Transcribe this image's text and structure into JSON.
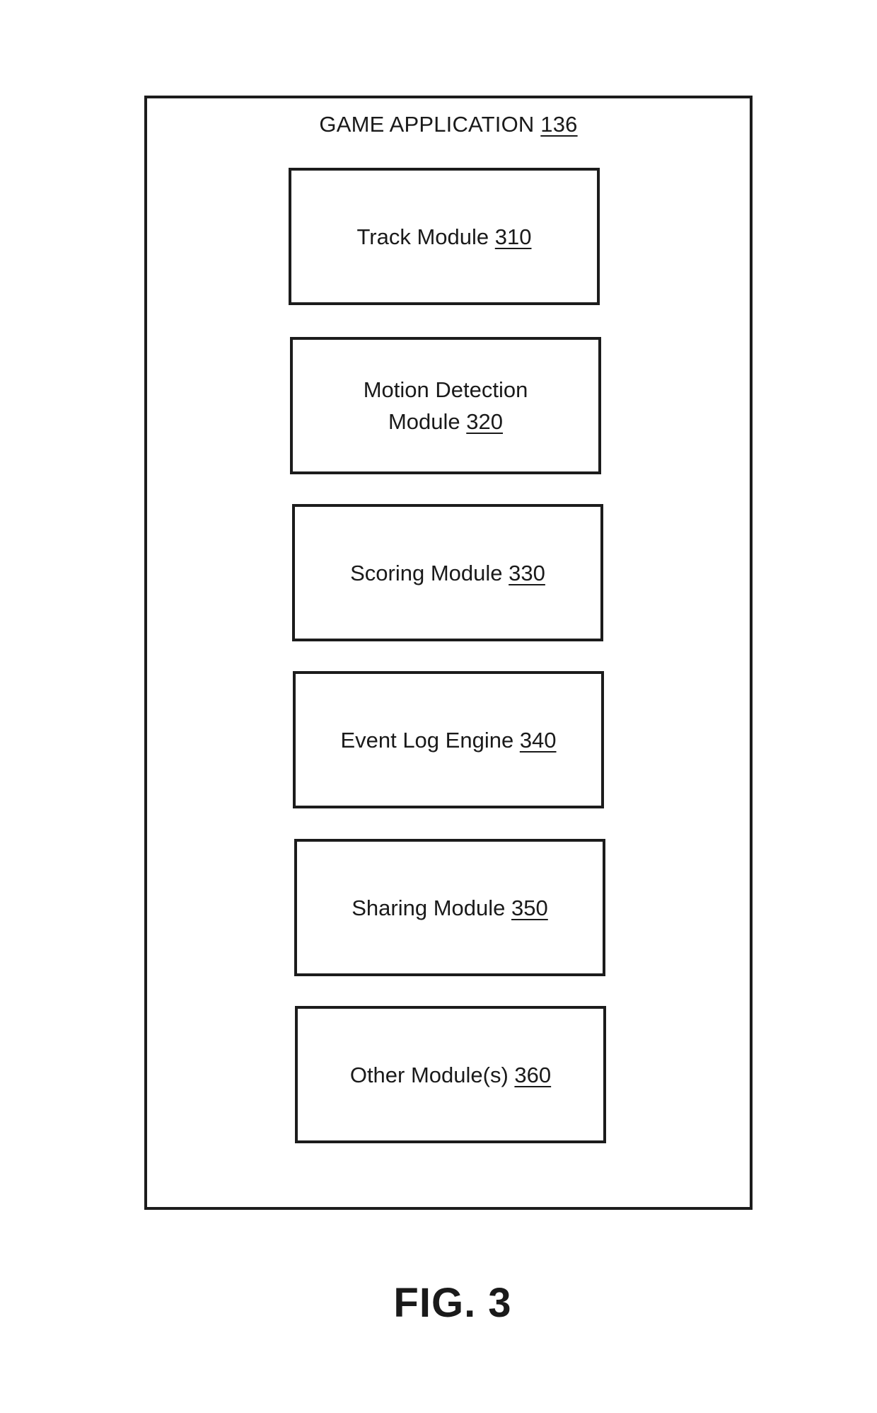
{
  "container": {
    "title": "GAME APPLICATION",
    "ref": "136"
  },
  "modules": [
    {
      "lines": [
        "Track Module"
      ],
      "ref": "310"
    },
    {
      "lines": [
        "Motion Detection",
        "Module"
      ],
      "ref": "320"
    },
    {
      "lines": [
        "Scoring Module"
      ],
      "ref": "330"
    },
    {
      "lines": [
        "Event Log Engine"
      ],
      "ref": "340"
    },
    {
      "lines": [
        "Sharing Module"
      ],
      "ref": "350"
    },
    {
      "lines": [
        "Other Module(s)"
      ],
      "ref": "360"
    }
  ],
  "figure_label": "FIG. 3"
}
